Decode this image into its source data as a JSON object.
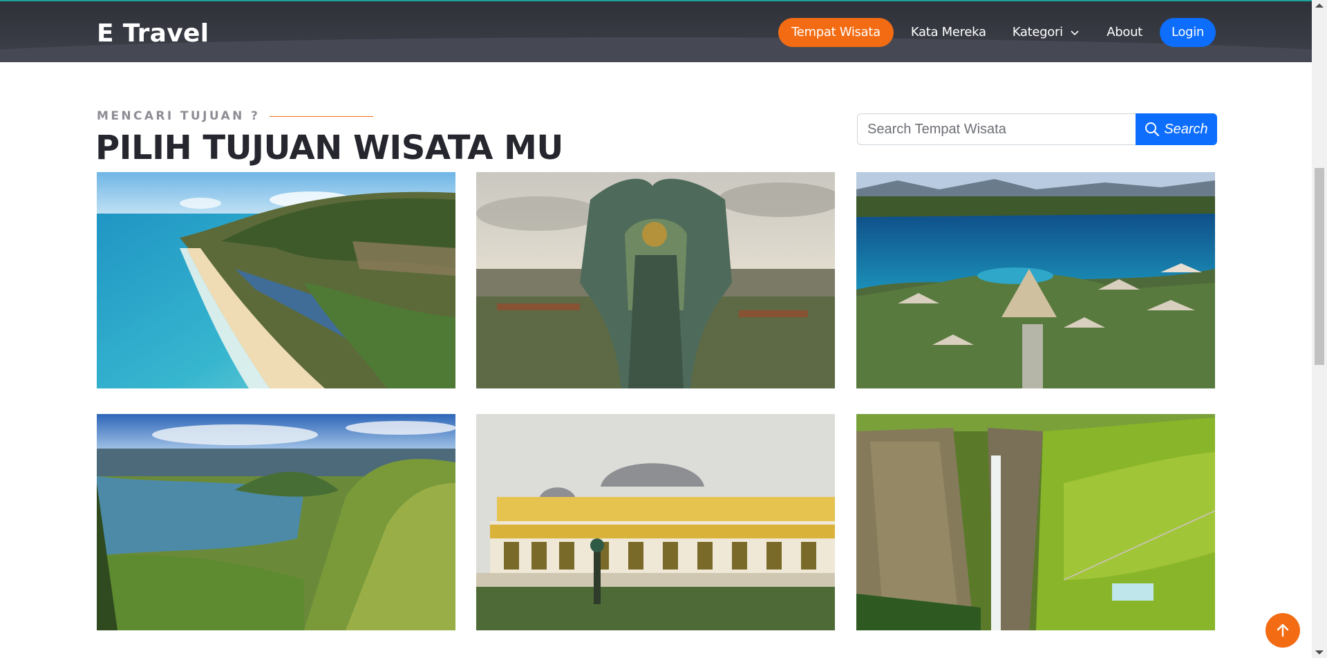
{
  "brand": {
    "name": "E Travel"
  },
  "nav": {
    "items": [
      {
        "label": "Tempat Wisata",
        "active": true
      },
      {
        "label": "Kata Mereka"
      },
      {
        "label": "Kategori",
        "dropdown": true
      },
      {
        "label": "About"
      }
    ],
    "login_label": "Login"
  },
  "section": {
    "eyebrow": "MENCARI TUJUAN ?",
    "title": "PILIH TUJUAN WISATA MU"
  },
  "search": {
    "placeholder": "Search Tempat Wisata",
    "value": "",
    "button_label": "Search"
  },
  "destinations": [
    {
      "image": "beach-cliff-aerial"
    },
    {
      "image": "garuda-statue"
    },
    {
      "image": "lagoon-resort-aerial"
    },
    {
      "image": "lake-mountain-valley"
    },
    {
      "image": "palace-building"
    },
    {
      "image": "waterfall-canyon"
    }
  ],
  "colors": {
    "accent": "#f36c14",
    "primary": "#0d6efd",
    "header_bg": "#3b3d46",
    "heading": "#25262e"
  },
  "icons": {
    "search": "search-icon",
    "dropdown": "chevron-down-icon",
    "back_to_top": "arrow-up-icon"
  }
}
